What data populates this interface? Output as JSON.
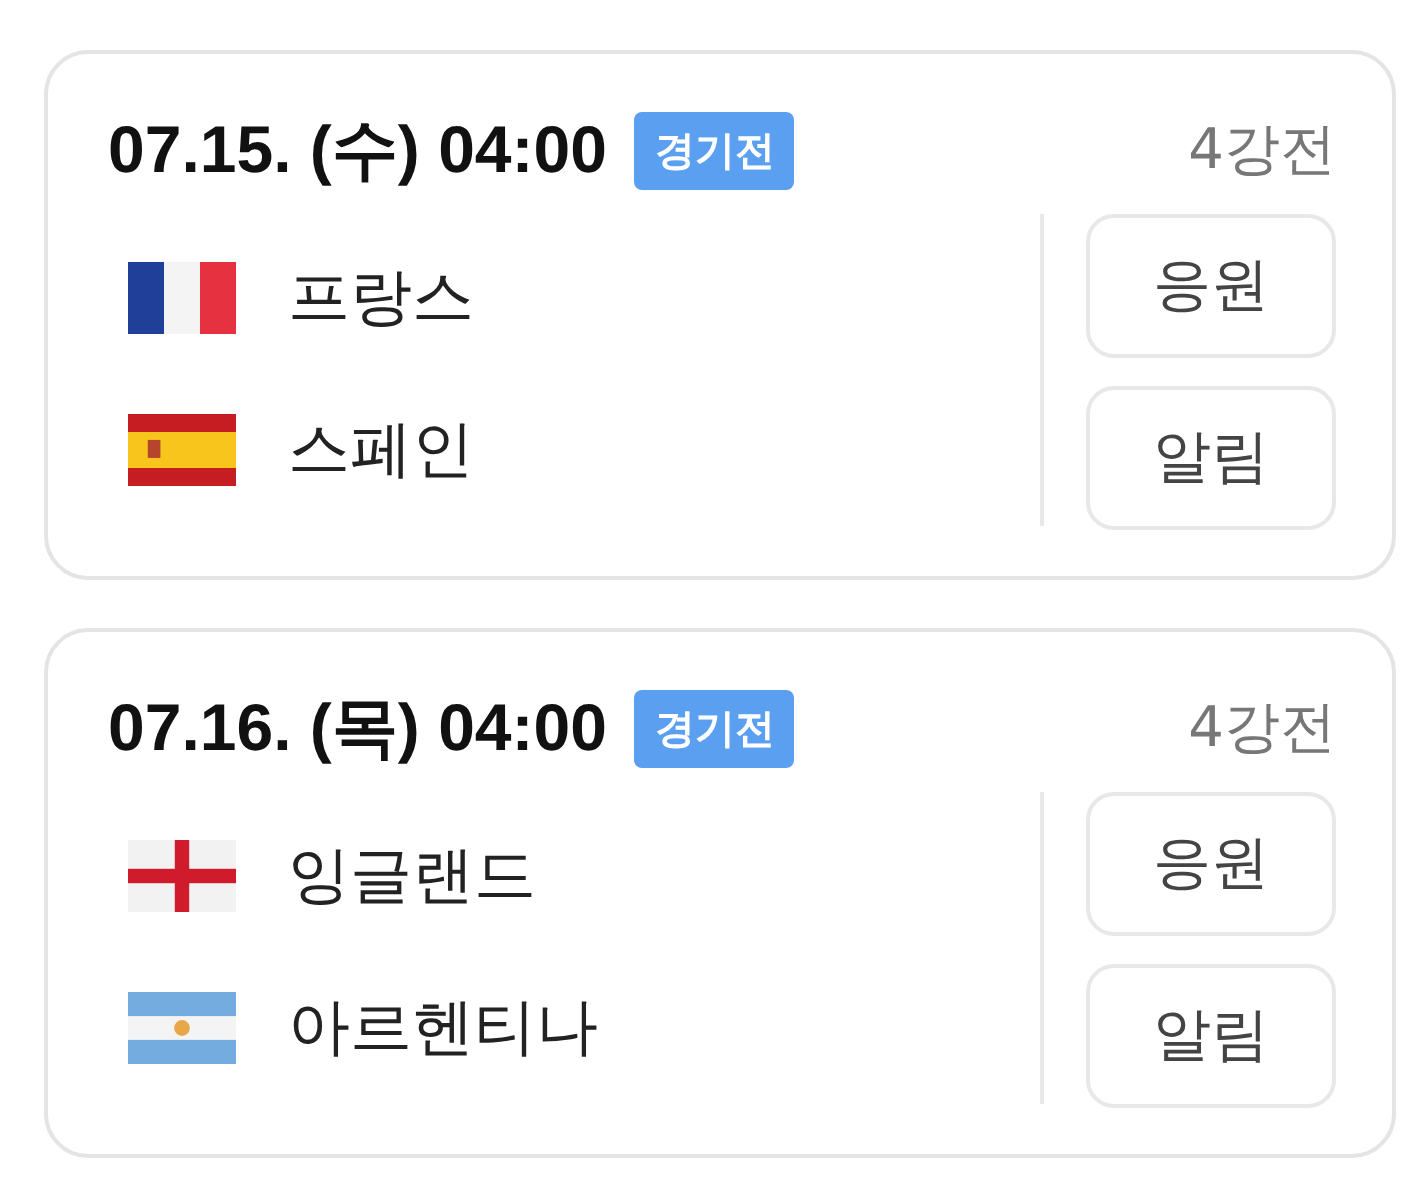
{
  "matches": [
    {
      "datetime": "07.15. (수) 04:00",
      "status": "경기전",
      "round": "4강전",
      "teams": [
        {
          "kind": "france",
          "name": "프랑스"
        },
        {
          "kind": "spain",
          "name": "스페인"
        }
      ],
      "buttons": [
        "응원",
        "알림"
      ]
    },
    {
      "datetime": "07.16. (목) 04:00",
      "status": "경기전",
      "round": "4강전",
      "teams": [
        {
          "kind": "england",
          "name": "잉글랜드"
        },
        {
          "kind": "argentina",
          "name": "아르헨티나"
        }
      ],
      "buttons": [
        "응원",
        "알림"
      ]
    }
  ]
}
